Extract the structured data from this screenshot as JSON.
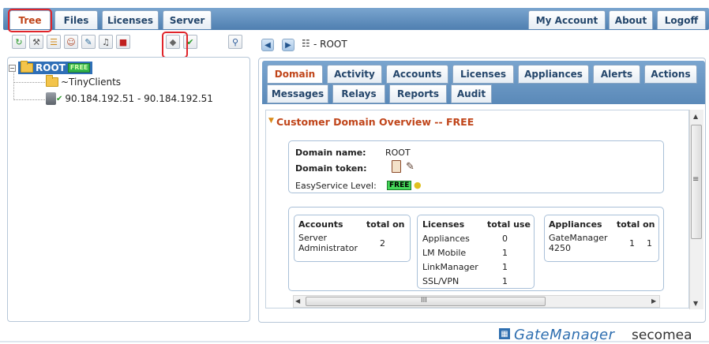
{
  "top_tabs": {
    "tree": "Tree",
    "files": "Files",
    "licenses": "Licenses",
    "server": "Server",
    "my_account": "My Account",
    "about": "About",
    "logoff": "Logoff"
  },
  "toolbar": {
    "icons": [
      "refresh-icon",
      "tools-icon",
      "tree-icon",
      "user-icon",
      "edit-icon",
      "alarm-bell-icon",
      "toolbox-icon",
      "appliance-icon",
      "appliance-check-icon",
      "search-icon"
    ]
  },
  "tree": {
    "root_label": "ROOT",
    "root_badge": "FREE",
    "child_folder": "~TinyClients",
    "appliance": "90.184.192.51 - 90.184.192.51"
  },
  "breadcrumb": {
    "text": "- ROOT"
  },
  "sub_tabs": {
    "row1": [
      "Domain",
      "Activity",
      "Accounts",
      "Licenses",
      "Appliances",
      "Alerts",
      "Actions"
    ],
    "row2": [
      "Messages",
      "Relays",
      "Reports",
      "Audit"
    ]
  },
  "overview": {
    "title": "Customer Domain Overview -- FREE",
    "domain_name_label": "Domain name:",
    "domain_name_value": "ROOT",
    "domain_token_label": "Domain token:",
    "easyservice_label": "EasyService Level:",
    "easyservice_value": "FREE"
  },
  "accounts": {
    "header": "Accounts",
    "col": "total on",
    "rows": [
      {
        "name_line1": "Server",
        "name_line2": "Administrator",
        "total": "2"
      }
    ]
  },
  "licenses": {
    "header": "Licenses",
    "col": "total use",
    "rows": [
      {
        "name": "Appliances",
        "total": "0"
      },
      {
        "name": "LM Mobile",
        "total": "1"
      },
      {
        "name": "LinkManager",
        "total": "1"
      },
      {
        "name": "SSL/VPN",
        "total": "1"
      }
    ]
  },
  "appliances": {
    "header": "Appliances",
    "col": "total on",
    "rows": [
      {
        "name_line1": "GateManager",
        "name_line2": "4250",
        "total": "1",
        "on": "1"
      }
    ]
  },
  "scrollbar": {
    "h_grip": "III",
    "v_grip": "≡"
  },
  "footer": {
    "product": "GateManager",
    "brand": "secomea"
  },
  "colors": {
    "accent_orange": "#c0451a",
    "tab_text_blue": "#24466b",
    "bar_blue": "#5a89b8",
    "highlight_red": "#e0242a",
    "badge_green": "#32b44a"
  }
}
